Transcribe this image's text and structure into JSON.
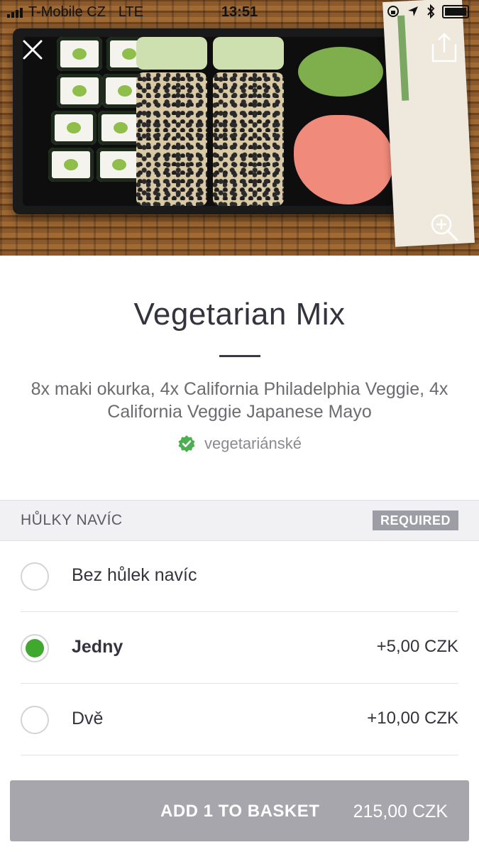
{
  "status_bar": {
    "carrier": "T-Mobile CZ",
    "network": "LTE",
    "time": "13:51"
  },
  "hero": {
    "image_subject": "sushi-tray"
  },
  "item": {
    "title": "Vegetarian Mix",
    "description": "8x maki okurka, 4x California Philadelphia Veggie, 4x California Veggie Japanese Mayo",
    "badge_label": "vegetariánské",
    "badge_color": "#4caf50"
  },
  "options_section": {
    "title": "HŮLKY NAVÍC",
    "required_label": "REQUIRED",
    "options": [
      {
        "label": "Bez hůlek navíc",
        "price": "",
        "selected": false
      },
      {
        "label": "Jedny",
        "price": "+5,00 CZK",
        "selected": true
      },
      {
        "label": "Dvě",
        "price": "+10,00 CZK",
        "selected": false
      }
    ]
  },
  "cta": {
    "label": "ADD 1 TO BASKET",
    "price": "215,00 CZK"
  },
  "colors": {
    "accent_green": "#3fa82f",
    "cta_bg": "#a6a6ac"
  }
}
